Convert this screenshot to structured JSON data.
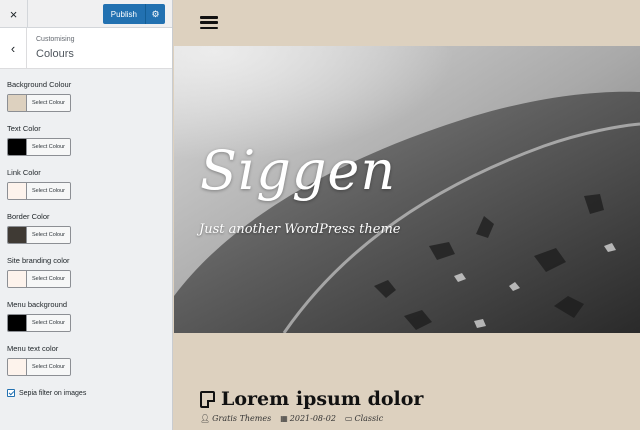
{
  "toolbar": {
    "close_icon": "×",
    "publish_label": "Publish",
    "settings_icon": "⚙"
  },
  "section": {
    "back_icon": "‹",
    "breadcrumb": "Customising",
    "title": "Colours"
  },
  "controls": [
    {
      "label": "Background Colour",
      "button": "Select Colour",
      "color": "#ddd1bf"
    },
    {
      "label": "Text Color",
      "button": "Select Colour",
      "color": "#000000"
    },
    {
      "label": "Link Color",
      "button": "Select Colour",
      "color": "#fdf3ec"
    },
    {
      "label": "Border Color",
      "button": "Select Colour",
      "color": "#3f3a34"
    },
    {
      "label": "Site branding color",
      "button": "Select Colour",
      "color": "#fdf3ec"
    },
    {
      "label": "Menu background",
      "button": "Select Colour",
      "color": "#000000"
    },
    {
      "label": "Menu text color",
      "button": "Select Colour",
      "color": "#fdf3ec"
    }
  ],
  "sepia": {
    "label": "Sepia filter on images",
    "checked": true
  },
  "site": {
    "title": "Siggen",
    "tagline": "Just another WordPress theme"
  },
  "post": {
    "title": "Lorem ipsum dolor",
    "author": "Gratis Themes",
    "date": "2021-08-02",
    "category": "Classic"
  },
  "colors": {
    "accent": "#2271b1",
    "background": "#ddd1bf"
  }
}
